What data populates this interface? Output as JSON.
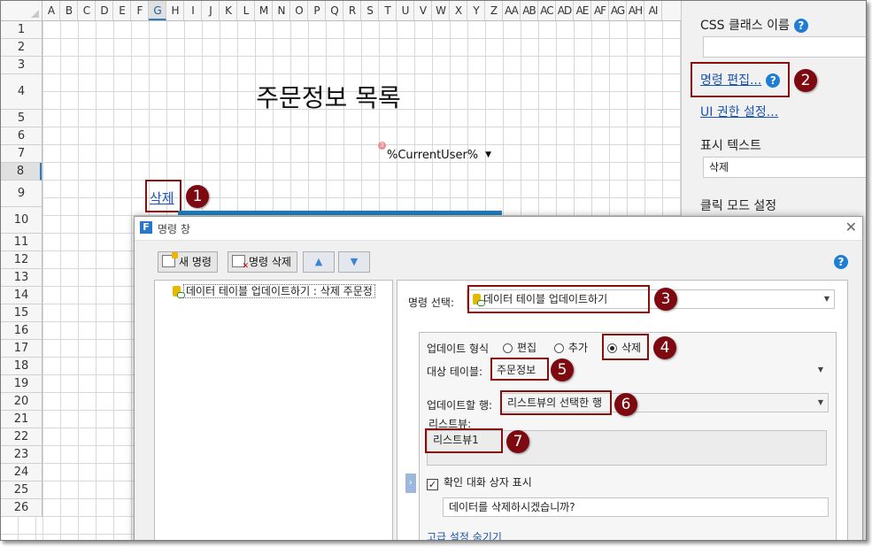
{
  "sheet": {
    "columns": [
      "A",
      "B",
      "C",
      "D",
      "E",
      "F",
      "G",
      "H",
      "I",
      "J",
      "K",
      "L",
      "M",
      "N",
      "O",
      "P",
      "Q",
      "R",
      "S",
      "T",
      "U",
      "V",
      "W",
      "X",
      "Y",
      "Z",
      "AA",
      "AB",
      "AC",
      "AD",
      "AE",
      "AF",
      "AG",
      "AH",
      "AI"
    ],
    "selected_column": "G",
    "rows": [
      "1",
      "2",
      "3",
      "4",
      "5",
      "6",
      "7",
      "8",
      "9",
      "10",
      "11",
      "12",
      "13",
      "14",
      "15",
      "16",
      "17",
      "18",
      "19",
      "20",
      "21",
      "22",
      "23",
      "24",
      "25",
      "26"
    ],
    "selected_row": "8",
    "title": "주문정보 목록",
    "current_user": "%CurrentUser%",
    "badge": "3",
    "delete_link": "삭제"
  },
  "markers": [
    "1",
    "2",
    "3",
    "4",
    "5",
    "6",
    "7"
  ],
  "properties": {
    "css_class_label": "CSS 클래스 이름",
    "command_edit_link": "명령 편집...",
    "ui_permission_link": "UI 권한 설정...",
    "display_text_label": "표시 텍스트",
    "display_text_value": "삭제",
    "click_mode_label": "클릭 모드 설정",
    "help_glyph": "?"
  },
  "dialog": {
    "title": "명령 창",
    "logo": "F",
    "close": "✕",
    "new_command": "새 명령",
    "delete_command": "명령 삭제",
    "up": "▲",
    "down": "▼",
    "help": "?",
    "tree_item": "데이터 테이블 업데이트하기 : 삭제 주문정",
    "command_select_label": "명령 선택:",
    "command_select_value": "데이터 테이블 업데이트하기",
    "update_type_label": "업데이트 형식",
    "update_types": [
      "편집",
      "추가",
      "삭제"
    ],
    "selected_update_type": "삭제",
    "target_table_label": "대상 테이블:",
    "target_table_value": "주문정보",
    "update_row_label": "업데이트할 행:",
    "update_row_value": "리스트뷰의 선택한 행",
    "listview_label": "리스트뷰:",
    "listview_value": "리스트뷰1",
    "confirm_label": "확인 대화 상자 표시",
    "confirm_checked": true,
    "confirm_message": "데이터를 삭제하시겠습니까?",
    "advanced_link": "고급 설정 숨기기",
    "side_tab": "›"
  }
}
